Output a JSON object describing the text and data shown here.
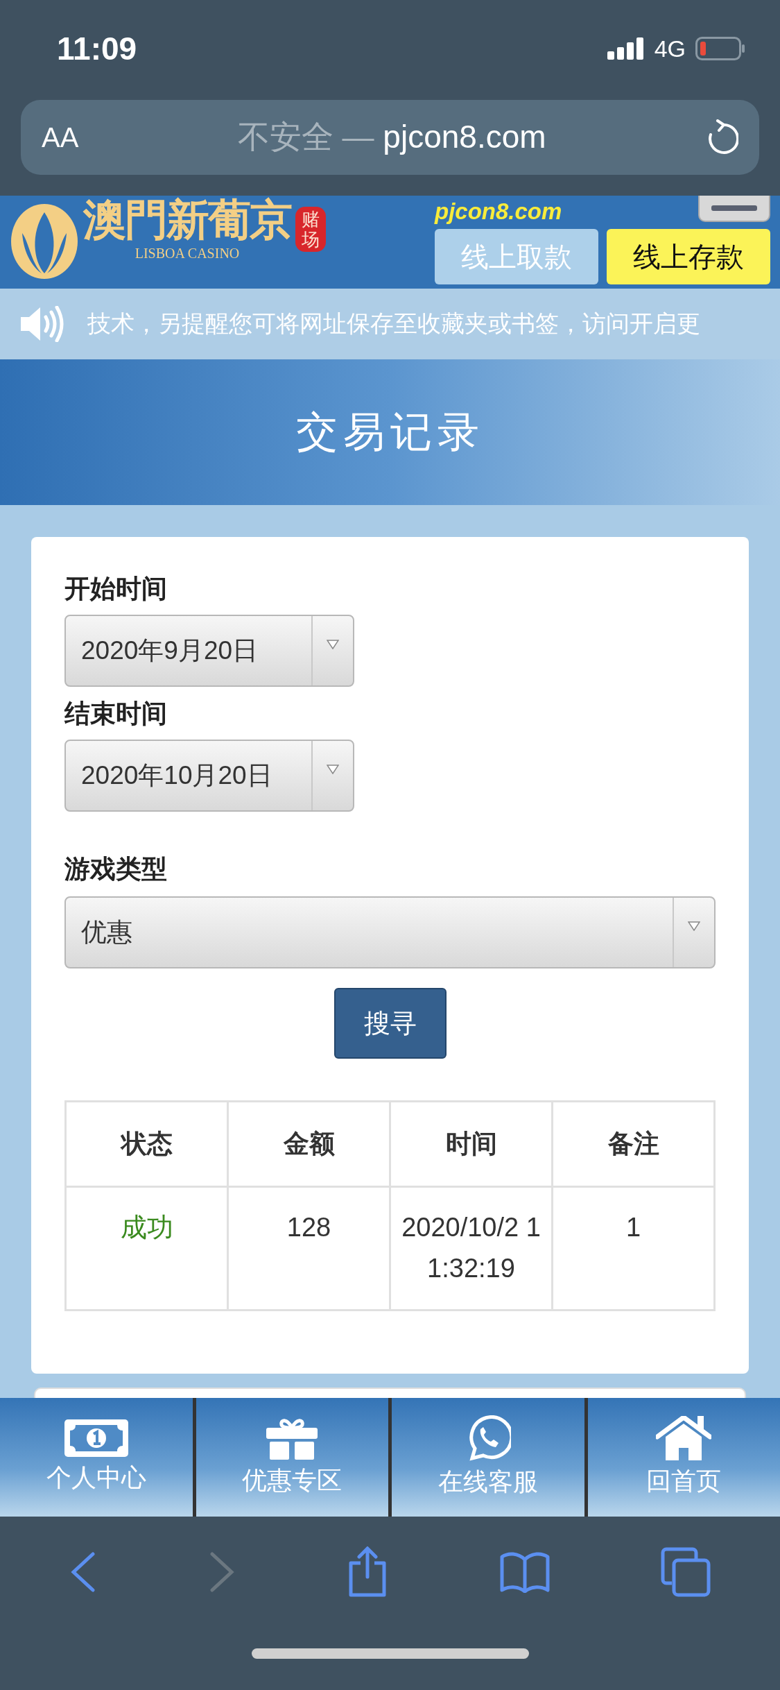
{
  "status_bar": {
    "time": "11:09",
    "network": "4G"
  },
  "address_bar": {
    "text_size": "AA",
    "security": "不安全 —",
    "domain": "pjcon8.com"
  },
  "site_header": {
    "logo_name": "澳門新葡京",
    "logo_seal": "赌场",
    "logo_subtitle": "LISBOA CASINO",
    "domain": "pjcon8.com",
    "buttons": [
      {
        "label": "线上取款",
        "kind": "secondary"
      },
      {
        "label": "线上存款",
        "kind": "primary"
      }
    ]
  },
  "notice": {
    "text": "技术，另提醒您可将网址保存至收藏夹或书签，访问开启更"
  },
  "page_title": "交易记录",
  "form": {
    "fields": [
      {
        "label": "开始时间",
        "value": "2020年9月20日",
        "kind": "short"
      },
      {
        "label": "结束时间",
        "value": "2020年10月20日",
        "kind": "short"
      },
      {
        "label": "游戏类型",
        "value": "优惠",
        "kind": "wide"
      }
    ],
    "search_button": "搜寻"
  },
  "table": {
    "columns": [
      "状态",
      "金额",
      "时间",
      "备注"
    ],
    "rows": [
      {
        "status": "成功",
        "color": "#3a8a1e",
        "amount": "128",
        "time": "2020/10/2 11:32:19",
        "note": "1"
      }
    ]
  },
  "bottom_nav": [
    {
      "label": "个人中心"
    },
    {
      "label": "优惠专区"
    },
    {
      "label": "在线客服"
    },
    {
      "label": "回首页"
    }
  ],
  "browser_toolbar": {
    "back_disabled": false,
    "forward_disabled": true
  }
}
